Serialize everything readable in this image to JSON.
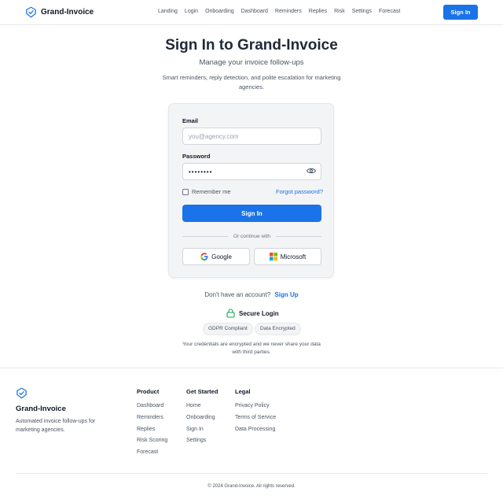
{
  "header": {
    "brand": "Grand-Invoice",
    "nav": [
      "Landing",
      "Login",
      "Onboarding",
      "Dashboard",
      "Reminders",
      "Replies",
      "Risk",
      "Settings",
      "Forecast"
    ],
    "signin_label": "Sign In"
  },
  "hero": {
    "title": "Sign In to Grand-Invoice",
    "subtitle": "Manage your invoice follow-ups",
    "description": "Smart reminders, reply detection, and polite escalation for marketing agencies."
  },
  "form": {
    "email_label": "Email",
    "email_placeholder": "you@agency.com",
    "email_value": "",
    "password_label": "Password",
    "password_value": "••••••••",
    "remember_label": "Remember me",
    "remember_checked": false,
    "forgot_label": "Forgot password?",
    "submit_label": "Sign In",
    "divider_text": "Or continue with",
    "google_label": "Google",
    "microsoft_label": "Microsoft"
  },
  "signup": {
    "prompt": "Don't have an account?",
    "link": "Sign Up"
  },
  "security": {
    "title": "Secure Login",
    "badges": [
      "GDPR Compliant",
      "Data Encrypted"
    ],
    "note": "Your credentials are encrypted and we never share your data with third parties."
  },
  "footer": {
    "brand": "Grand-Invoice",
    "tagline": "Automated invoice follow-ups for marketing agencies.",
    "columns": [
      {
        "title": "Product",
        "links": [
          "Dashboard",
          "Reminders",
          "Replies",
          "Risk Scoring",
          "Forecast"
        ]
      },
      {
        "title": "Get Started",
        "links": [
          "Home",
          "Onboarding",
          "Sign In",
          "Settings"
        ]
      },
      {
        "title": "Legal",
        "links": [
          "Privacy Policy",
          "Terms of Service",
          "Data Processing"
        ]
      }
    ],
    "copyright": "© 2024 Grand-Invoice. All rights reserved."
  },
  "colors": {
    "accent": "#1a73e8",
    "brand_icon": "#1a73e8",
    "lock_icon": "#16a34a"
  },
  "icons": {
    "logo": "shield-check-icon",
    "password_toggle": "eye-icon",
    "google": "google-icon",
    "microsoft": "microsoft-icon",
    "secure": "lock-icon"
  }
}
